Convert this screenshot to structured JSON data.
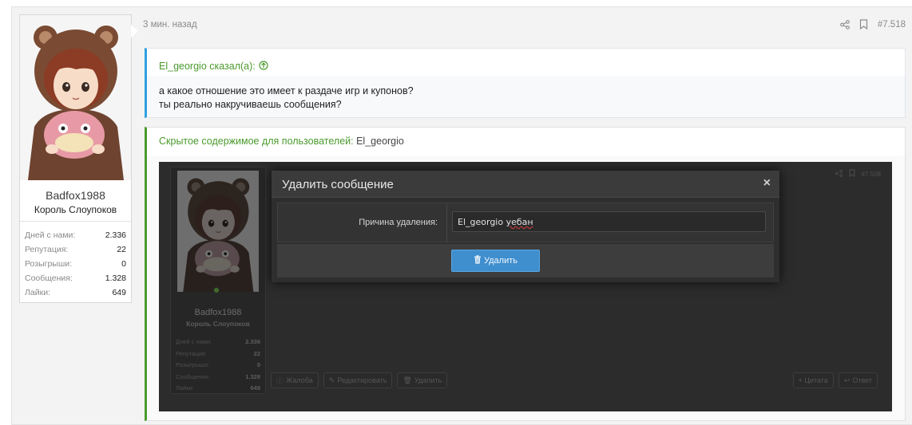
{
  "post": {
    "time": "3 мин. назад",
    "number": "#7.518"
  },
  "user": {
    "name": "Badfox1988",
    "title": "Король Слоупоков",
    "stats": [
      {
        "label": "Дней с нами:",
        "value": "2.336"
      },
      {
        "label": "Репутация:",
        "value": "22"
      },
      {
        "label": "Розыгрыши:",
        "value": "0"
      },
      {
        "label": "Сообщения:",
        "value": "1.328"
      },
      {
        "label": "Лайки:",
        "value": "649"
      }
    ]
  },
  "quote": {
    "author": "El_georgio сказал(а):",
    "line1": "а какое отношение это имеет к раздаче игр и купонов?",
    "line2": "ты реально накручиваешь сообщения?"
  },
  "hidden": {
    "prefix": "Скрытое содержимое для пользователей:",
    "user": "El_georgio"
  },
  "screenshot": {
    "number": "#7.508",
    "user_name": "Badfox1988",
    "user_title": "Король Слоупоков",
    "stats": [
      {
        "label": "Дней с нами:",
        "value": "2.336"
      },
      {
        "label": "Репутация:",
        "value": "22"
      },
      {
        "label": "Розыгрыши:",
        "value": "0"
      },
      {
        "label": "Сообщения:",
        "value": "1.328"
      },
      {
        "label": "Лайки:",
        "value": "649"
      }
    ],
    "actions_left": [
      "Жалоба",
      "Редактировать",
      "Удалить"
    ],
    "actions_right": [
      "+ Цитата",
      "Ответ"
    ],
    "modal": {
      "title": "Удалить сообщение",
      "close": "×",
      "reason_label": "Причина удаления:",
      "reason_value_a": "El_georgio",
      "reason_value_b": "уебан",
      "delete_label": "Удалить"
    }
  },
  "colors": {
    "accent_green": "#4a9a2c",
    "accent_blue": "#2ea0e0",
    "button_blue": "#3f8fcf"
  }
}
